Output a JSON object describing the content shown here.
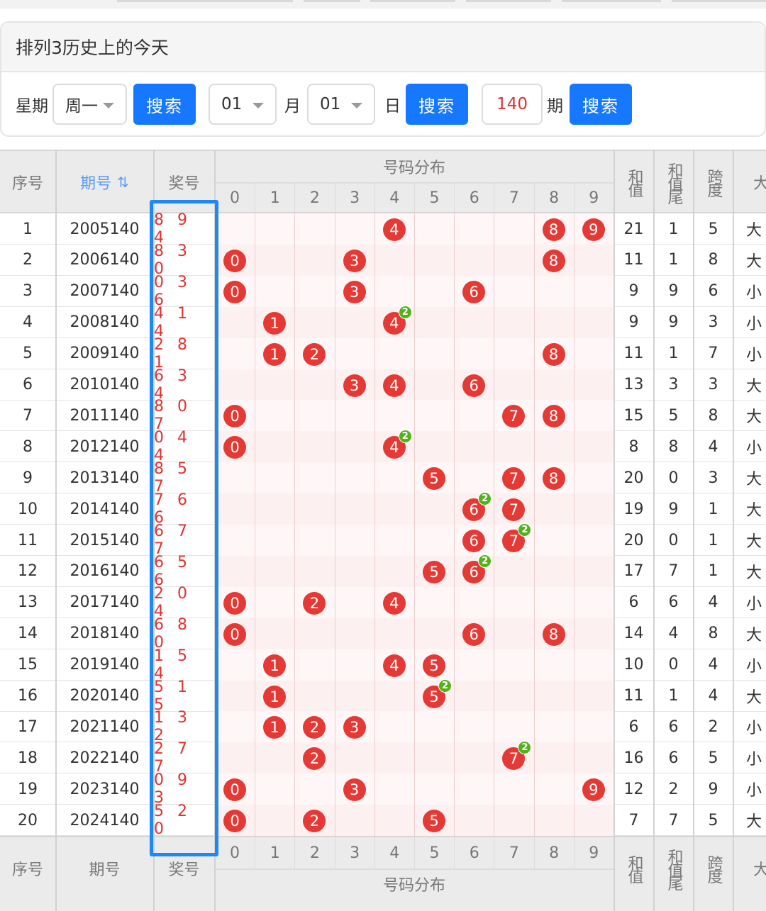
{
  "panel": {
    "title": "排列3历史上的今天",
    "weekday_label": "星期",
    "weekday_value": "周一",
    "search1": "搜索",
    "month_value": "01",
    "month_label": "月",
    "day_value": "01",
    "day_label": "日",
    "search2": "搜索",
    "issue_value": "140",
    "issue_label": "期",
    "search3": "搜索"
  },
  "table": {
    "col_seq": "序号",
    "col_period": "期号",
    "col_period_sort_icon": "sort-icon",
    "col_winning": "奖号",
    "col_dist": "号码分布",
    "col_sum": "和值",
    "col_sum_tail": "和值尾",
    "col_span": "跨度",
    "col_size": "大",
    "digits": [
      "0",
      "1",
      "2",
      "3",
      "4",
      "5",
      "6",
      "7",
      "8",
      "9"
    ],
    "rows": [
      {
        "seq": "1",
        "period": "2005140",
        "num": "894",
        "sum": "21",
        "tail": "1",
        "span": "5",
        "size": "大"
      },
      {
        "seq": "2",
        "period": "2006140",
        "num": "830",
        "sum": "11",
        "tail": "1",
        "span": "8",
        "size": "大"
      },
      {
        "seq": "3",
        "period": "2007140",
        "num": "036",
        "sum": "9",
        "tail": "9",
        "span": "6",
        "size": "小"
      },
      {
        "seq": "4",
        "period": "2008140",
        "num": "414",
        "sum": "9",
        "tail": "9",
        "span": "3",
        "size": "小"
      },
      {
        "seq": "5",
        "period": "2009140",
        "num": "281",
        "sum": "11",
        "tail": "1",
        "span": "7",
        "size": "小"
      },
      {
        "seq": "6",
        "period": "2010140",
        "num": "634",
        "sum": "13",
        "tail": "3",
        "span": "3",
        "size": "大"
      },
      {
        "seq": "7",
        "period": "2011140",
        "num": "807",
        "sum": "15",
        "tail": "5",
        "span": "8",
        "size": "大"
      },
      {
        "seq": "8",
        "period": "2012140",
        "num": "044",
        "sum": "8",
        "tail": "8",
        "span": "4",
        "size": "小"
      },
      {
        "seq": "9",
        "period": "2013140",
        "num": "857",
        "sum": "20",
        "tail": "0",
        "span": "3",
        "size": "大"
      },
      {
        "seq": "10",
        "period": "2014140",
        "num": "766",
        "sum": "19",
        "tail": "9",
        "span": "1",
        "size": "大"
      },
      {
        "seq": "11",
        "period": "2015140",
        "num": "677",
        "sum": "20",
        "tail": "0",
        "span": "1",
        "size": "大"
      },
      {
        "seq": "12",
        "period": "2016140",
        "num": "656",
        "sum": "17",
        "tail": "7",
        "span": "1",
        "size": "大"
      },
      {
        "seq": "13",
        "period": "2017140",
        "num": "204",
        "sum": "6",
        "tail": "6",
        "span": "4",
        "size": "小"
      },
      {
        "seq": "14",
        "period": "2018140",
        "num": "680",
        "sum": "14",
        "tail": "4",
        "span": "8",
        "size": "大"
      },
      {
        "seq": "15",
        "period": "2019140",
        "num": "154",
        "sum": "10",
        "tail": "0",
        "span": "4",
        "size": "小"
      },
      {
        "seq": "16",
        "period": "2020140",
        "num": "515",
        "sum": "11",
        "tail": "1",
        "span": "4",
        "size": "大"
      },
      {
        "seq": "17",
        "period": "2021140",
        "num": "132",
        "sum": "6",
        "tail": "6",
        "span": "2",
        "size": "小"
      },
      {
        "seq": "18",
        "period": "2022140",
        "num": "277",
        "sum": "16",
        "tail": "6",
        "span": "5",
        "size": "小"
      },
      {
        "seq": "19",
        "period": "2023140",
        "num": "093",
        "sum": "12",
        "tail": "2",
        "span": "9",
        "size": "小"
      },
      {
        "seq": "20",
        "period": "2024140",
        "num": "520",
        "sum": "7",
        "tail": "7",
        "span": "5",
        "size": "大"
      }
    ]
  },
  "colors": {
    "accent": "#1677ff",
    "ball": "#e53935",
    "badge": "#52b21a",
    "highlight_box": "#1e88f5"
  }
}
